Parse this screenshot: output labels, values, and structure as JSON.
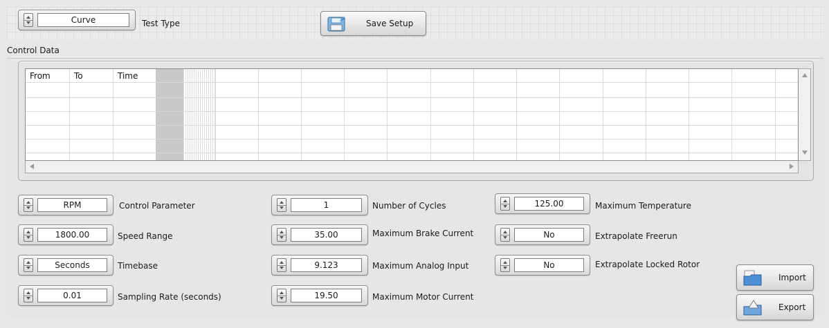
{
  "toolbar": {
    "test_type_value": "Curve",
    "test_type_label": "Test Type",
    "save_setup_label": "Save Setup"
  },
  "control_data": {
    "title": "Control Data",
    "columns": [
      "From",
      "To",
      "Time"
    ]
  },
  "controls_left": [
    {
      "value": "RPM",
      "label": "Control Parameter"
    },
    {
      "value": "1800.00",
      "label": "Speed Range"
    },
    {
      "value": "Seconds",
      "label": "Timebase"
    },
    {
      "value": "0.01",
      "label": "Sampling Rate (seconds)"
    }
  ],
  "controls_mid": [
    {
      "value": "1",
      "label": "Number of Cycles"
    },
    {
      "value": "35.00",
      "label": "Maximum Brake Current"
    },
    {
      "value": "9.123",
      "label": "Maximum Analog Input"
    },
    {
      "value": "19.50",
      "label": "Maximum Motor Current"
    }
  ],
  "controls_right": [
    {
      "value": "125.00",
      "label": "Maximum Temperature"
    },
    {
      "value": "No",
      "label": "Extrapolate Freerun"
    },
    {
      "value": "No",
      "label": "Extrapolate Locked Rotor"
    }
  ],
  "buttons": {
    "import_label": "Import",
    "export_label": "Export"
  },
  "icons": {
    "save": "floppy-disk-icon",
    "import": "folder-import-icon",
    "export": "export-icon"
  }
}
